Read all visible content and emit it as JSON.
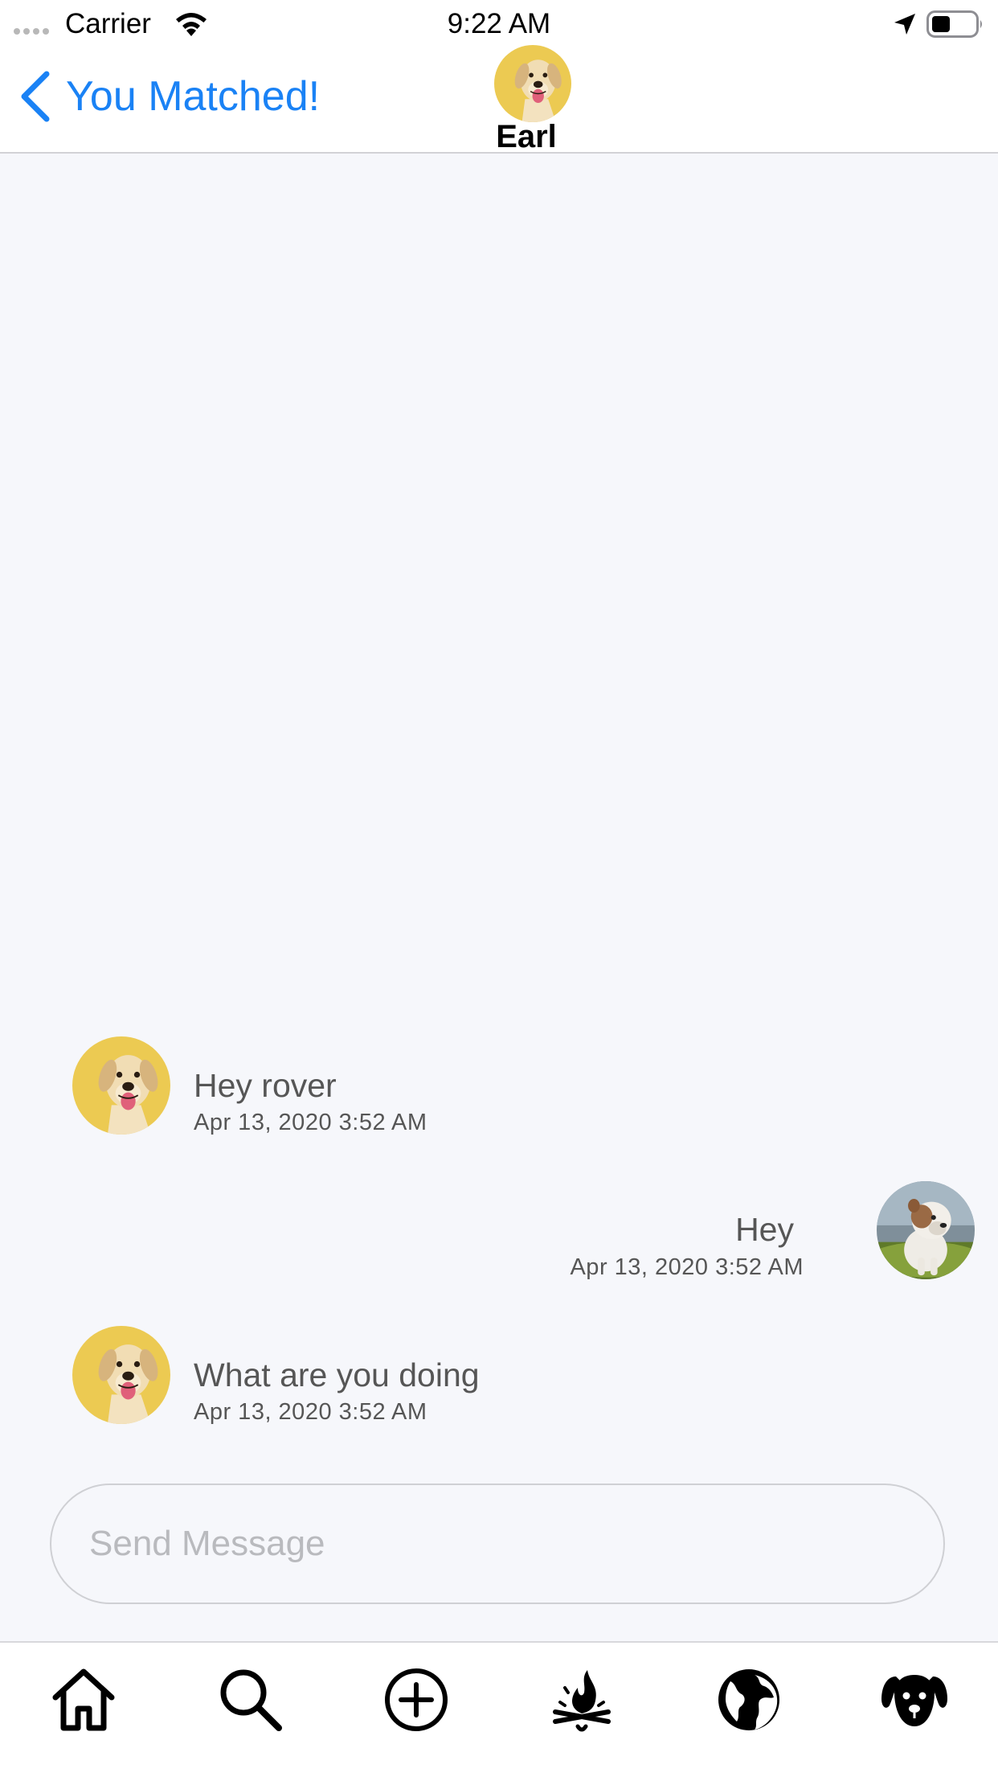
{
  "status_bar": {
    "carrier": "Carrier",
    "time": "9:22 AM",
    "icons": [
      "signal-dots-icon",
      "wifi-icon",
      "location-arrow-icon",
      "battery-icon"
    ]
  },
  "nav": {
    "back_label": "You Matched!",
    "title": "Earl",
    "avatar_icon": "dog-avatar-labrador"
  },
  "messages": [
    {
      "side": "left",
      "text": "Hey rover",
      "time": "Apr 13, 2020 3:52 AM",
      "avatar": "labrador-avatar"
    },
    {
      "side": "right",
      "text": "Hey",
      "time": "Apr 13, 2020 3:52 AM",
      "avatar": "bulldog-avatar"
    },
    {
      "side": "left",
      "text": "What are you doing",
      "time": "Apr 13, 2020 3:52 AM",
      "avatar": "labrador-avatar"
    }
  ],
  "composer": {
    "placeholder": "Send Message",
    "value": ""
  },
  "tab_bar": {
    "items": [
      "home-icon",
      "search-icon",
      "add-icon",
      "campfire-icon",
      "globe-icon",
      "dog-icon"
    ]
  },
  "colors": {
    "accent": "#1a82f5",
    "chat_background": "#f6f7fb",
    "avatar_yellow": "#ecca52",
    "text_gray": "#565656",
    "placeholder_gray": "#b9babe"
  }
}
